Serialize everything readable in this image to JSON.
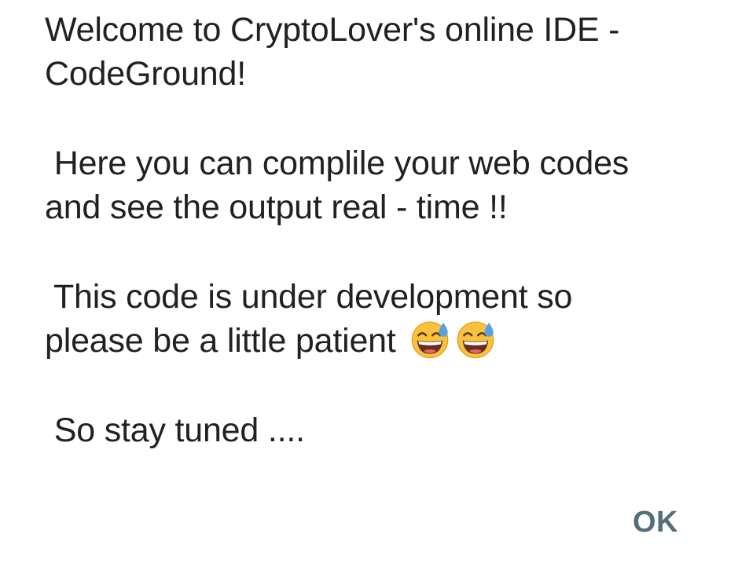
{
  "dialog": {
    "message_lines": {
      "l1": "Welcome to CryptoLover's online IDE -",
      "l2": "CodeGround!",
      "l3": " Here you can complile your web codes",
      "l4": "and see the output real - time !!",
      "l5": " This code is under development so",
      "l6": "please be a little patient ",
      "l7": " So stay tuned ...."
    },
    "emoji": {
      "name": "grinning-face-with-sweat-icon",
      "count": 2,
      "face_color": "#F9C23C",
      "sweat_color": "#5C9FE0"
    },
    "ok_label": "OK",
    "text_color": "#212121",
    "button_color": "#546E7A",
    "background": "#FFFFFF"
  }
}
